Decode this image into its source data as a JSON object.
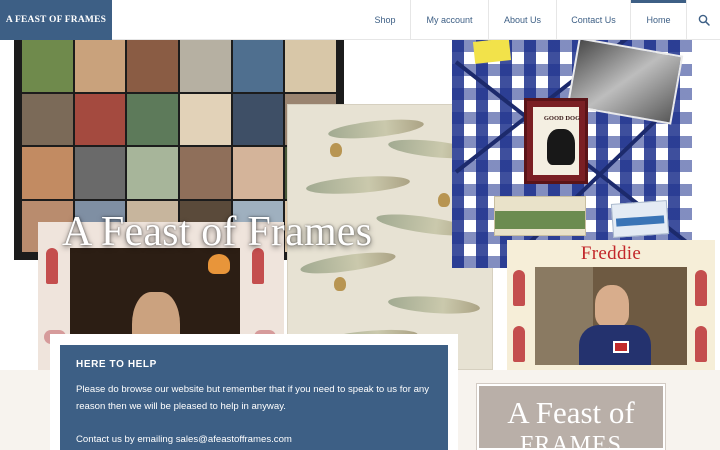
{
  "header": {
    "brand": "A FEAST OF FRAMES",
    "nav": [
      {
        "label": "Shop"
      },
      {
        "label": "My account"
      },
      {
        "label": "About Us"
      },
      {
        "label": "Contact Us"
      },
      {
        "label": "Home",
        "active": true
      }
    ],
    "search_icon": "search-icon"
  },
  "hero": {
    "title": "A Feast of Frames",
    "pieces": {
      "noticeboard_card": "GOOD DOG",
      "frame_label": "Freddie"
    }
  },
  "help": {
    "heading": "HERE TO HELP",
    "body": "Please do browse our website but remember that if you need to speak to us for any reason then we will be pleased to help in anyway.",
    "contact": "Contact us by emailing sales@afeastofframes.com"
  },
  "sidebar_logo": {
    "line1": "A Feast of",
    "line2": "FRAMES"
  },
  "colors": {
    "brand": "#3d5f85",
    "lower_background": "#f7f3ee"
  }
}
